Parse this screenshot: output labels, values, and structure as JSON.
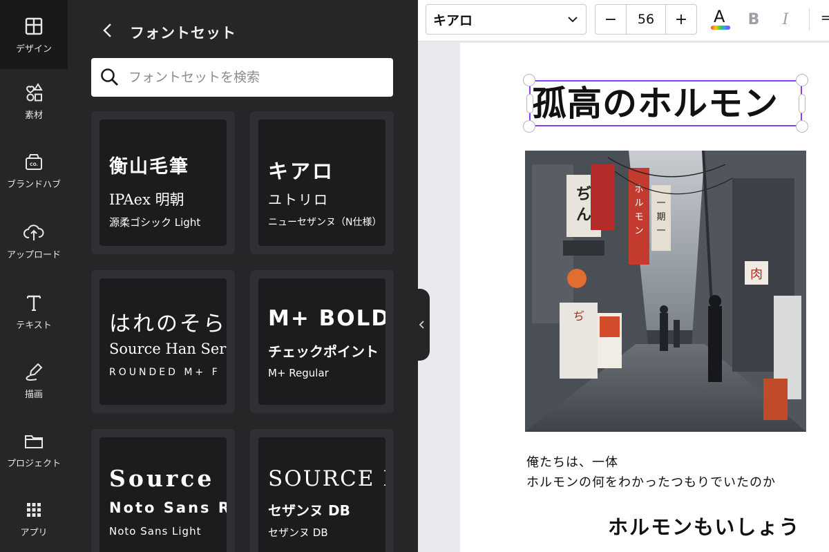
{
  "rail": {
    "items": [
      {
        "label": "デザイン",
        "icon": "layout-icon"
      },
      {
        "label": "素材",
        "icon": "shapes-icon"
      },
      {
        "label": "ブランドハブ",
        "icon": "brand-icon"
      },
      {
        "label": "アップロード",
        "icon": "upload-icon"
      },
      {
        "label": "テキスト",
        "icon": "text-icon"
      },
      {
        "label": "描画",
        "icon": "draw-icon"
      },
      {
        "label": "プロジェクト",
        "icon": "folder-icon"
      },
      {
        "label": "アプリ",
        "icon": "apps-icon"
      }
    ]
  },
  "panel": {
    "title": "フォントセット",
    "search_placeholder": "フォントセットを検索",
    "cards": [
      {
        "l1": "衡山毛筆",
        "l2": "IPAex 明朝",
        "l3": "源柔ゴシック Light"
      },
      {
        "l1": "キアロ",
        "l2": "ユトリロ",
        "l3": "ニューセザンヌ（N仕様）"
      },
      {
        "l1": "はれのそら",
        "l2": "Source Han Serif",
        "l3": "ROUNDED M+ F"
      },
      {
        "l1": "M+ BOLD",
        "l2": "チェックポイント",
        "l3": "M+ Regular"
      },
      {
        "l1": "Source",
        "l2": "Noto Sans R",
        "l3": "Noto Sans Light"
      },
      {
        "l1": "SOURCE I",
        "l2": "セザンヌ DB",
        "l3": "セザンヌ DB"
      }
    ]
  },
  "toolbar": {
    "font_name": "キアロ",
    "font_size": "56",
    "minus": "−",
    "plus": "+",
    "color_letter": "A",
    "bold": "B",
    "italic": "I"
  },
  "canvas": {
    "title": "孤高のホルモン",
    "body_line1": "俺たちは、一体",
    "body_line2": "ホルモンの何をわかったつもりでいたのか",
    "footer": "ホルモンもいしょう"
  },
  "colors": {
    "selection": "#8b3dff",
    "rail_bg": "#18191b",
    "panel_bg": "#252627"
  }
}
